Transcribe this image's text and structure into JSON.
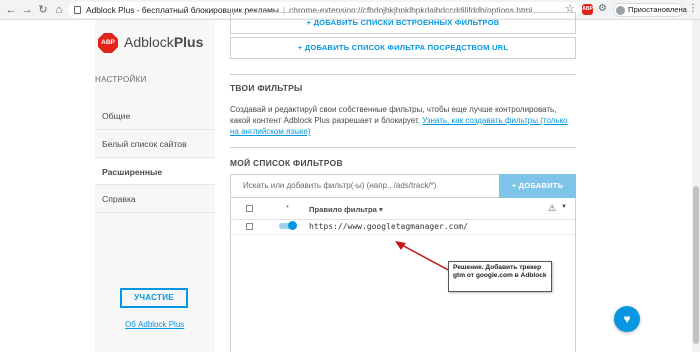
{
  "browser": {
    "tab_title": "Adblock Plus - бесплатный блокировщик рекламы",
    "url": "chrome-extension://cfhdojbkjhnklbpkdaibdccddilifddb/options.html",
    "paused_label": "Приостановлена",
    "ext_badge": "ABP"
  },
  "sidebar": {
    "logo_text": "ABP",
    "brand_normal": "Adblock",
    "brand_bold": "Plus",
    "settings_heading": "НАСТРОЙКИ",
    "items": [
      {
        "label": "Общие"
      },
      {
        "label": "Белый список сайтов"
      },
      {
        "label": "Расширенные"
      },
      {
        "label": "Справка"
      }
    ],
    "contribute_label": "УЧАСТИЕ",
    "about_label": "Об Adblock Plus"
  },
  "main": {
    "add_builtin_lists_label": "+ ДОБАВИТЬ СПИСКИ ВСТРОЕННЫХ ФИЛЬТРОВ",
    "add_list_by_url_label": "+ ДОБАВИТЬ СПИСОК ФИЛЬТРА ПОСРЕДСТВОМ URL",
    "your_filters_heading": "ТВОИ ФИЛЬТРЫ",
    "your_filters_desc": "Создавай и редактируй свои собственные фильтры, чтобы еще лучше контролировать, какой контент Adblock Plus разрешает и блокирует.",
    "your_filters_link": "Узнать, как создавать фильтры (только на английском языке)",
    "my_list_heading": "МОЙ СПИСОК ФИЛЬТРОВ",
    "search_placeholder": "Искать или добавить фильтр(-ы) (напр., /ads/track/*)",
    "add_button_label": "+ ДОБАВИТЬ",
    "table": {
      "column_rule": "Правило фильтра",
      "rows": [
        {
          "rule": "https://www.googletagmanager.com/",
          "enabled": true
        }
      ]
    }
  },
  "annotation": {
    "text": "Решение. Добавить трекер gtm от google.com в Adblock"
  }
}
